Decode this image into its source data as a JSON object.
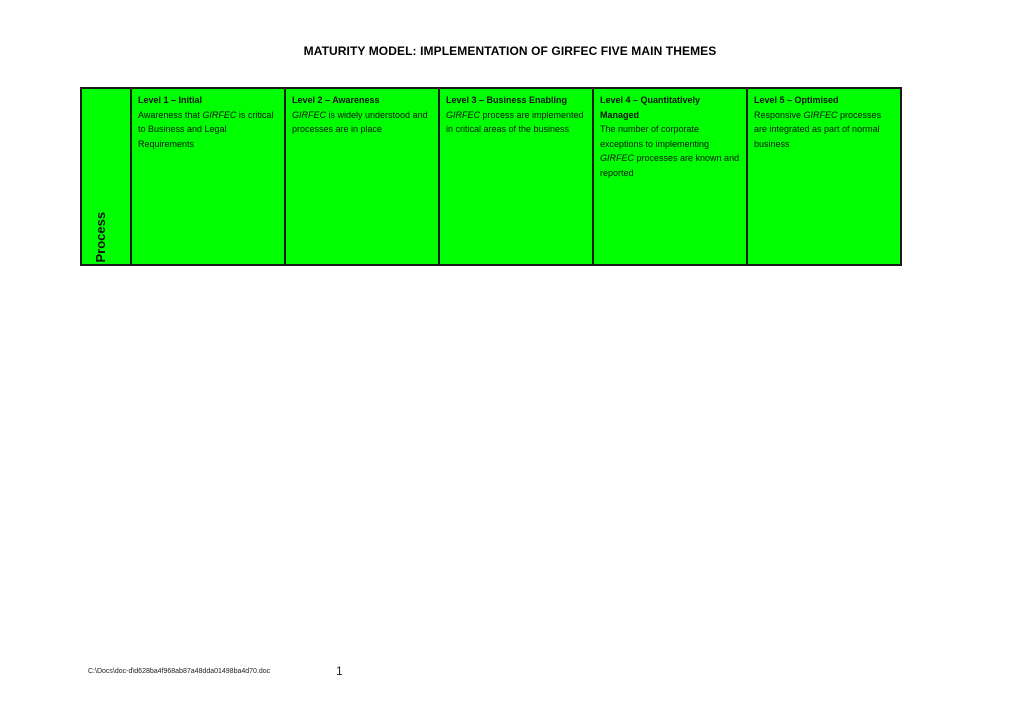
{
  "document": {
    "title": "MATURITY MODEL: IMPLEMENTATION OF GIRFEC FIVE MAIN THEMES"
  },
  "table": {
    "theme": "Process",
    "fill_color": "#00ff00",
    "levels": [
      {
        "heading": "Level 1 – Initial",
        "text_parts": [
          "Awareness that ",
          "GIRFEC",
          " is critical to Business and Legal Requirements"
        ]
      },
      {
        "heading": "Level 2 – Awareness",
        "text_parts": [
          "",
          "GIRFEC",
          " is widely understood and processes are in place"
        ]
      },
      {
        "heading": "Level 3 – Business Enabling",
        "text_parts": [
          "",
          "GIRFEC",
          " process are implemented in critical areas of the business"
        ]
      },
      {
        "heading": "Level 4 – Quantitatively Managed",
        "text_parts": [
          "The number of corporate exceptions to implementing ",
          "GIRFEC",
          " processes are known and reported"
        ]
      },
      {
        "heading": "Level 5 – Optimised",
        "text_parts": [
          "Responsive ",
          "GIRFEC",
          " processes are integrated as part of normal business"
        ]
      }
    ]
  },
  "footer": {
    "path": "C:\\Docs\\doc-d\\d628ba4f968ab87a48dda01498ba4d70.doc",
    "page_number": "1"
  }
}
